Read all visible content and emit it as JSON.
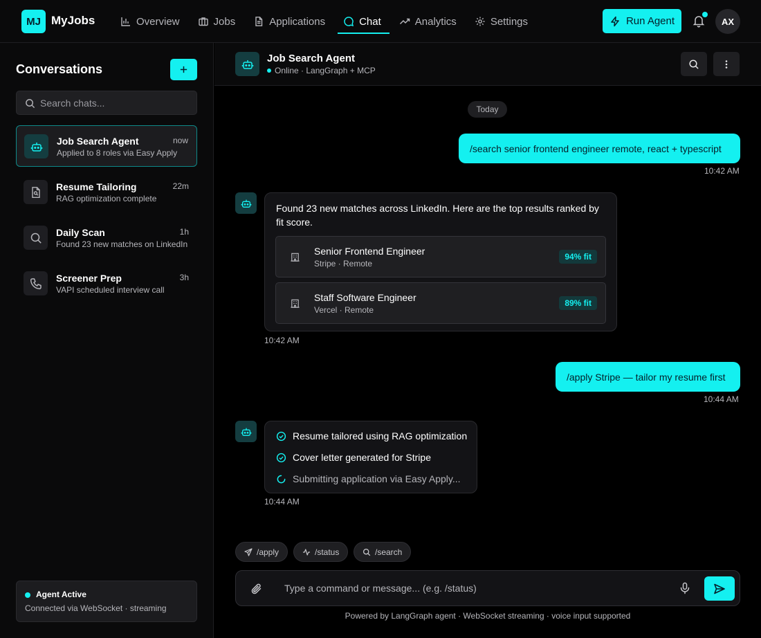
{
  "brand": {
    "badge": "MJ",
    "name": "MyJobs"
  },
  "nav": {
    "items": [
      {
        "label": "Overview",
        "icon": "bar-chart-icon",
        "active": false
      },
      {
        "label": "Jobs",
        "icon": "briefcase-icon",
        "active": false
      },
      {
        "label": "Applications",
        "icon": "document-icon",
        "active": false
      },
      {
        "label": "Chat",
        "icon": "chat-bubble-icon",
        "active": true
      },
      {
        "label": "Analytics",
        "icon": "trend-icon",
        "active": false
      },
      {
        "label": "Settings",
        "icon": "gear-icon",
        "active": false
      }
    ],
    "run_agent": "Run Agent",
    "avatar": "AX",
    "accent": "#14f0f0"
  },
  "sidebar": {
    "title": "Conversations",
    "new_chat": "+",
    "search_placeholder": "Search chats...",
    "conversations": [
      {
        "name": "Job Search Agent",
        "subtitle": "Applied to 8 roles via Easy Apply",
        "time": "now",
        "icon": "robot-icon",
        "active": true
      },
      {
        "name": "Resume Tailoring",
        "subtitle": "RAG optimization complete",
        "time": "22m",
        "icon": "document-search-icon",
        "active": false
      },
      {
        "name": "Daily Scan",
        "subtitle": "Found 23 new matches on LinkedIn",
        "time": "1h",
        "icon": "search-icon",
        "active": false
      },
      {
        "name": "Screener Prep",
        "subtitle": "VAPI scheduled interview call",
        "time": "3h",
        "icon": "phone-icon",
        "active": false
      }
    ],
    "agent_status": {
      "title": "Agent Active",
      "subtitle": "Connected via WebSocket · streaming"
    }
  },
  "chat": {
    "title": "Job Search Agent",
    "status": "Online · LangGraph + MCP",
    "day_divider": "Today",
    "messages": [
      {
        "from": "user",
        "text": "/search senior frontend engineer remote, react + typescript",
        "time": "10:42 AM"
      },
      {
        "from": "agent",
        "text": "Found 23 new matches across LinkedIn. Here are the top results ranked by fit score.",
        "time": "10:42 AM",
        "jobs": [
          {
            "title": "Senior Frontend Engineer",
            "company": "Stripe · Remote",
            "fit": "94% fit"
          },
          {
            "title": "Staff Software Engineer",
            "company": "Vercel · Remote",
            "fit": "89% fit"
          }
        ]
      },
      {
        "from": "user",
        "text": "/apply Stripe — tailor my resume first",
        "time": "10:44 AM"
      },
      {
        "from": "agent",
        "time": "10:44 AM",
        "steps": [
          {
            "text": "Resume tailored using RAG optimization",
            "done": true
          },
          {
            "text": "Cover letter generated for Stripe",
            "done": true
          },
          {
            "text": "Submitting application via Easy Apply...",
            "done": false
          }
        ]
      }
    ],
    "quick_commands": [
      "/apply",
      "/status",
      "/search"
    ],
    "composer_placeholder": "Type a command or message... (e.g. /status)",
    "footer": "Powered by LangGraph agent · WebSocket streaming · voice input supported"
  }
}
